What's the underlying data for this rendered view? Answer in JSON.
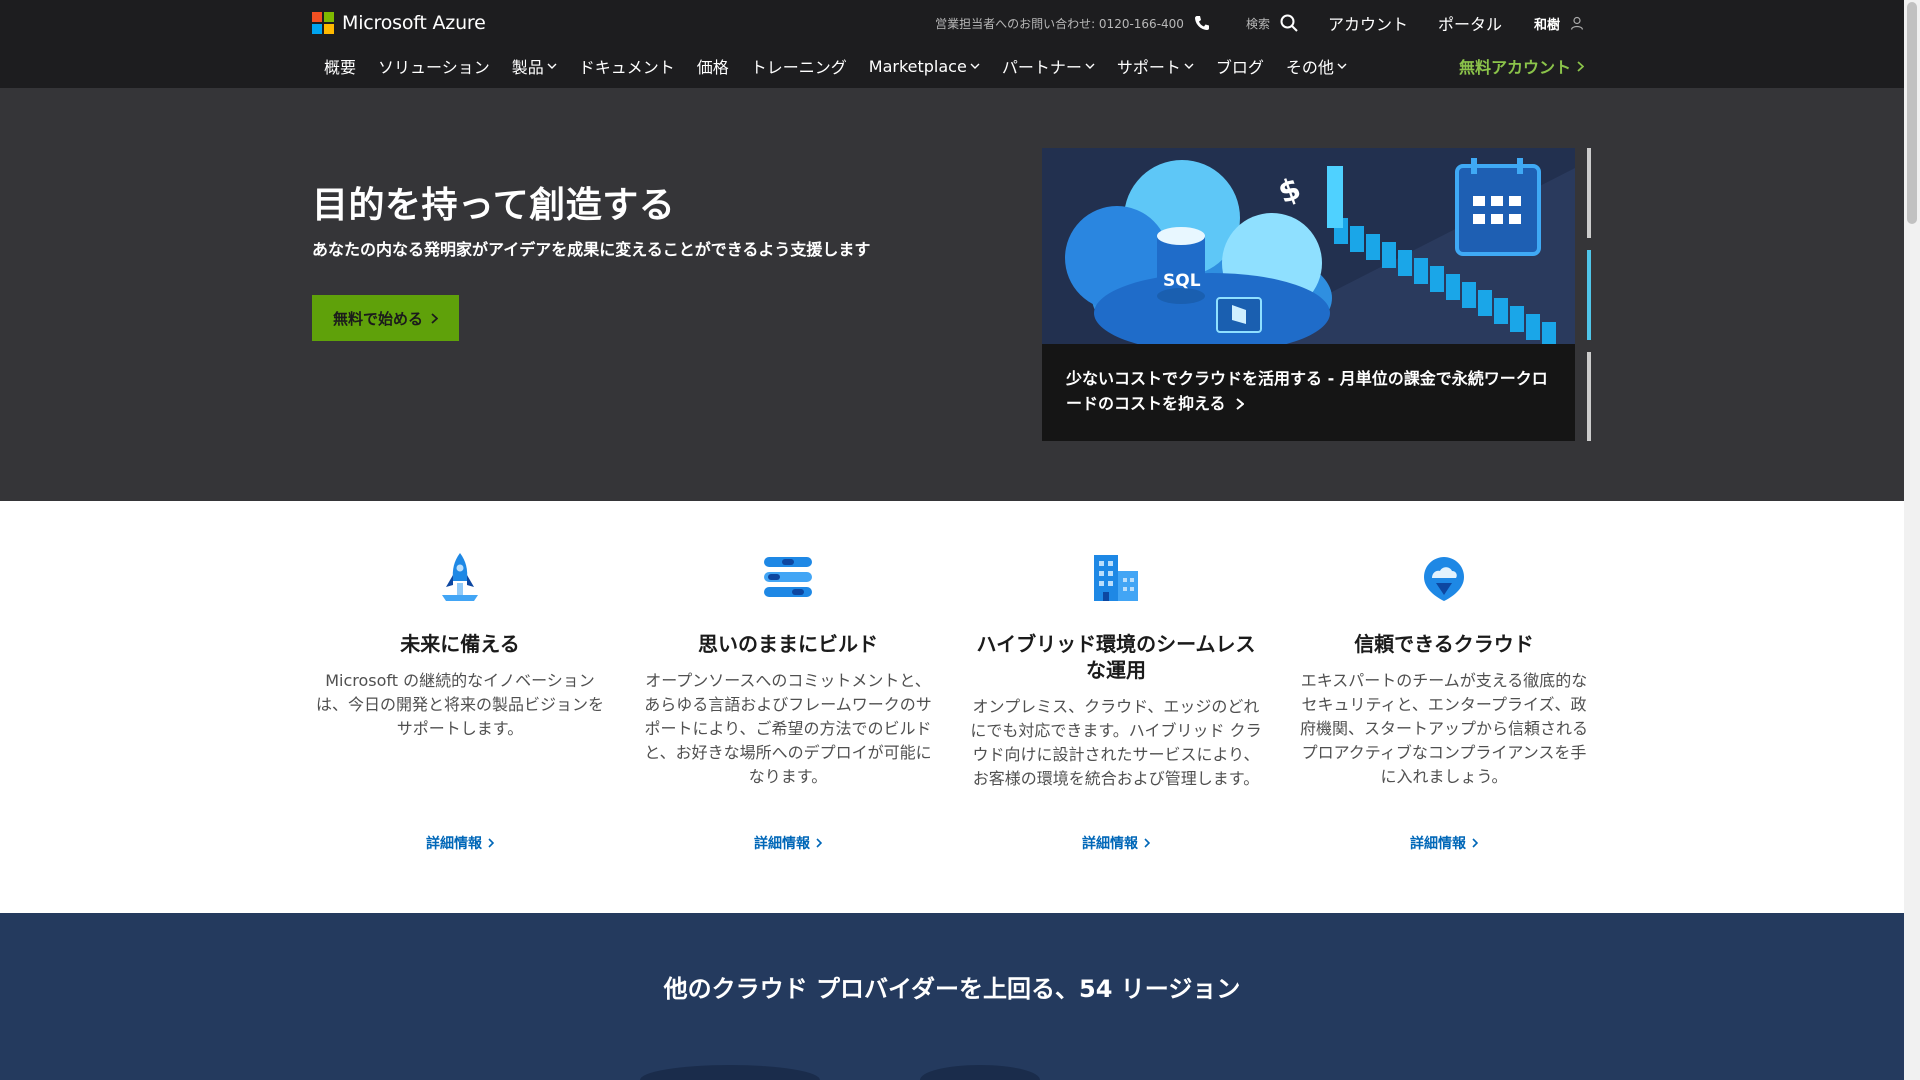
{
  "header": {
    "brand": "Microsoft Azure",
    "contact": "営業担当者へのお問い合わせ: 0120-166-400",
    "search_label": "検索",
    "account": "アカウント",
    "portal": "ポータル",
    "user_name": "和樹",
    "nav": [
      {
        "label": "概要",
        "dropdown": false
      },
      {
        "label": "ソリューション",
        "dropdown": false
      },
      {
        "label": "製品",
        "dropdown": true
      },
      {
        "label": "ドキュメント",
        "dropdown": false
      },
      {
        "label": "価格",
        "dropdown": false
      },
      {
        "label": "トレーニング",
        "dropdown": false
      },
      {
        "label": "Marketplace",
        "dropdown": true
      },
      {
        "label": "パートナー",
        "dropdown": true
      },
      {
        "label": "サポート",
        "dropdown": true
      },
      {
        "label": "ブログ",
        "dropdown": false
      },
      {
        "label": "その他",
        "dropdown": true
      }
    ],
    "free_account": "無料アカウント"
  },
  "hero": {
    "title": "目的を持って創造する",
    "subtitle": "あなたの内なる発明家がアイデアを成果に変えることができるよう支援します",
    "cta": "無料で始める",
    "carousel": {
      "badge": "SQL",
      "caption_line1": "少ないコストでクラウドを活用する - 月単位の課金で永続ワークロ",
      "caption_line2": "ードのコストを抑える"
    }
  },
  "features": [
    {
      "icon": "rocket-icon",
      "title_line1": "未来に備える",
      "title_line2": "",
      "body_lines": [
        "Microsoft の継続的なイノベーション",
        "は、今日の開発と将来の製品ビジョンを",
        "サポートします。"
      ],
      "more": "詳細情報"
    },
    {
      "icon": "build-icon",
      "title_line1": "思いのままにビルド",
      "title_line2": "",
      "body_lines": [
        "オープンソースへのコミットメントと、",
        "あらゆる言語およびフレームワークのサ",
        "ポートにより、ご希望の方法でのビルド",
        "と、お好きな場所へのデプロイが可能に",
        "なります。"
      ],
      "more": "詳細情報"
    },
    {
      "icon": "building-icon",
      "title_line1": "ハイブリッド環境のシームレス",
      "title_line2": "な運用",
      "body_lines": [
        "オンプレミス、クラウド、エッジのどれ",
        "にでも対応できます。ハイブリッド クラ",
        "ウド向けに設計されたサービスにより、",
        "お客様の環境を統合および管理します。"
      ],
      "more": "詳細情報"
    },
    {
      "icon": "shield-cloud-icon",
      "title_line1": "信頼できるクラウド",
      "title_line2": "",
      "body_lines": [
        "エキスパートのチームが支える徹底的な",
        "セキュリティと、エンタープライズ、政",
        "府機関、スタートアップから信頼される",
        "プロアクティブなコンプライアンスを手",
        "に入れましょう。"
      ],
      "more": "詳細情報"
    }
  ],
  "regions": {
    "title": "他のクラウド プロバイダーを上回る、54 リージョン"
  },
  "colors": {
    "header_bg": "#1d1d1f",
    "hero_bg": "#353538",
    "cta_green": "#5fa10a",
    "accent_blue": "#0067b8",
    "regions_bg": "#243a5e",
    "free_account_green": "#8bc34a"
  }
}
